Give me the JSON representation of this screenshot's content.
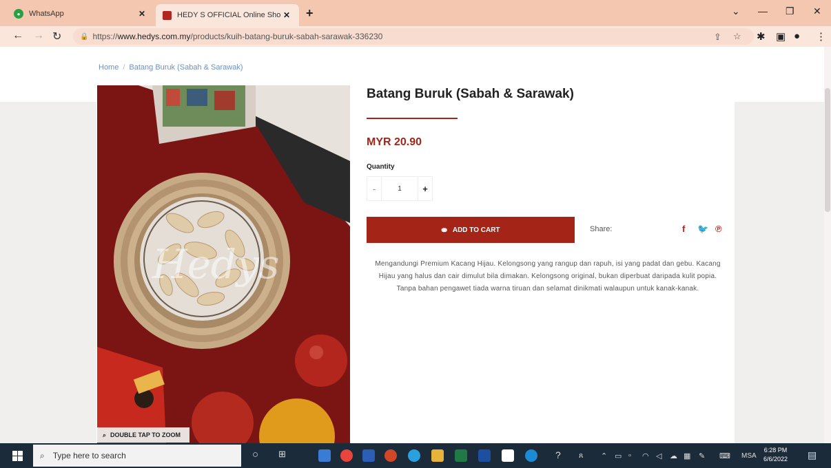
{
  "browser": {
    "tabs": [
      {
        "title": "WhatsApp",
        "active": false
      },
      {
        "title": "HEDY S OFFICIAL Online Shopp",
        "active": true
      }
    ],
    "url_prefix": "https://",
    "url_domain": "www.hedys.com.my",
    "url_path": "/products/kuih-batang-buruk-sabah-sarawak-336230",
    "icons": {
      "back": "arrow-left-icon",
      "forward": "arrow-right-icon",
      "reload": "reload-icon",
      "share": "share-icon",
      "bookmark": "star-icon",
      "extensions": "puzzle-icon",
      "sidepanel": "sidepanel-icon",
      "profile": "avatar",
      "menu": "kebab-menu-icon"
    }
  },
  "page": {
    "breadcrumb": [
      "Home",
      "Batang Buruk (Sabah & Sarawak)"
    ],
    "product": {
      "title": "Batang Buruk (Sabah & Sarawak)",
      "price": "MYR 20.90",
      "quantity_label": "Quantity",
      "quantity_value": "1",
      "minus": "-",
      "plus": "+",
      "add_to_cart": "ADD TO CART",
      "share_label": "Share:",
      "social": [
        "f",
        "tw",
        "p"
      ],
      "description": "Mengandungi Premium Kacang Hijau. Kelongsong yang rangup dan rapuh, isi yang padat dan gebu. Kacang Hijau yang halus dan cair dimulut bila dimakan. Kelongsong original, bukan diperbuat daripada kulit popia. Tanpa bahan pengawet tiada warna tiruan dan selamat dinikmati walaupun untuk kanak-kanak.",
      "image_watermark": "Hedys",
      "zoom_label": "DOUBLE TAP TO ZOOM"
    }
  },
  "taskbar": {
    "search_placeholder": "Type here to search",
    "language": "MSA",
    "time": "6:28 PM",
    "date": "6/6/2022"
  },
  "colors": {
    "accent": "#a42418",
    "tab_strip": "#f4c7b0",
    "taskbar": "#1c2b3a",
    "link": "#6a8fc8"
  }
}
